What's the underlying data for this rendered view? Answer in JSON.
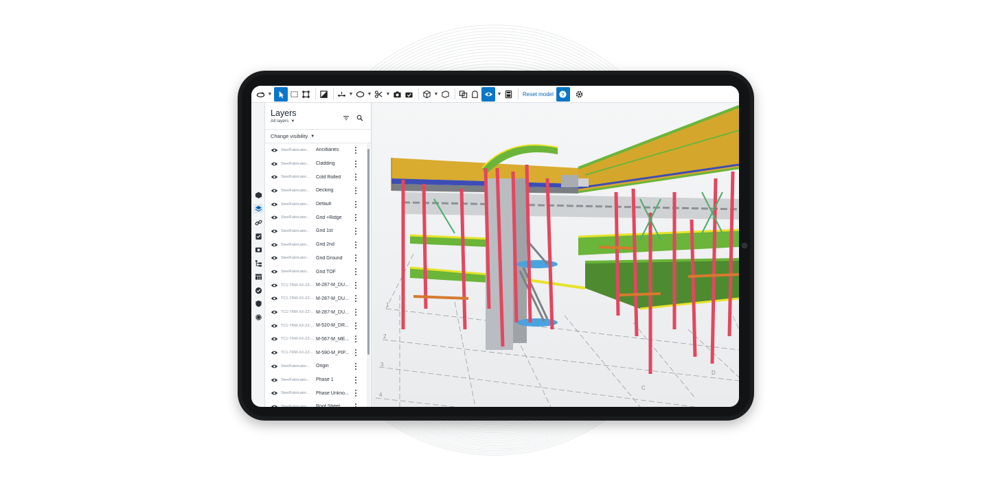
{
  "toolbar": {
    "reset_label": "Reset model",
    "tools": [
      "orbit-icon",
      "select-icon",
      "box-select-icon",
      "fit-icon",
      "section-icon",
      "measure-icon",
      "shape-icon",
      "cut-icon",
      "snapshot-icon",
      "snapshot-check-icon",
      "cube-icon",
      "plane-icon",
      "clash-icon",
      "lock-icon",
      "visibility-icon",
      "calculator-icon",
      "help-icon",
      "settings-icon"
    ],
    "accent": "#0a77c9"
  },
  "panel": {
    "title": "Layers",
    "subtitle": "All layers",
    "change_visibility": "Change visibility",
    "rows": [
      {
        "source": "SteelFabricator...",
        "name": "Ancilliaries"
      },
      {
        "source": "SteelFabricator...",
        "name": "Cladding"
      },
      {
        "source": "SteelFabricator...",
        "name": "Cold Rolled"
      },
      {
        "source": "SteelFabricator...",
        "name": "Decking"
      },
      {
        "source": "SteelFabricator...",
        "name": "Default"
      },
      {
        "source": "SteelFabricator...",
        "name": "Grid +Ridge"
      },
      {
        "source": "SteelFabricator...",
        "name": "Grid 1st"
      },
      {
        "source": "SteelFabricator...",
        "name": "Grid 2nd"
      },
      {
        "source": "SteelFabricator...",
        "name": "Grid Ground"
      },
      {
        "source": "SteelFabricator...",
        "name": "Grid TOF"
      },
      {
        "source": "TC1-TRM-XX-ZZ-...",
        "name": "M-287-M_DU..."
      },
      {
        "source": "TC1-TRM-XX-ZZ-...",
        "name": "M-287-M_DU..."
      },
      {
        "source": "TC1-TRM-XX-ZZ-...",
        "name": "M-287-M_DU..."
      },
      {
        "source": "TC1-TRM-XX-ZZ-...",
        "name": "M-520-M_DR..."
      },
      {
        "source": "TC1-TRM-XX-ZZ-...",
        "name": "M-567-M_ME..."
      },
      {
        "source": "TC1-TRM-XX-ZZ-...",
        "name": "M-590-M_PIP..."
      },
      {
        "source": "SteelFabricator...",
        "name": "Origin"
      },
      {
        "source": "SteelFabricator...",
        "name": "Phase 1"
      },
      {
        "source": "SteelFabricator...",
        "name": "Phase Unkno..."
      },
      {
        "source": "SteelFabricator...",
        "name": "Roof Sheet..."
      }
    ]
  },
  "rail": [
    "object-icon",
    "layers-icon",
    "link-icon",
    "checklist-icon",
    "camera-icon",
    "tree-icon",
    "table-icon",
    "status-icon",
    "shield-icon",
    "gear-icon"
  ],
  "viewport": {
    "grid_labels": [
      "1",
      "2",
      "3",
      "4",
      "C",
      "D"
    ],
    "colors": {
      "column": "#e2475f",
      "beam": "#6bb53a",
      "slab": "#4e8a2f",
      "roof": "#d4a72c",
      "lightblue": "#4aa3df"
    }
  }
}
